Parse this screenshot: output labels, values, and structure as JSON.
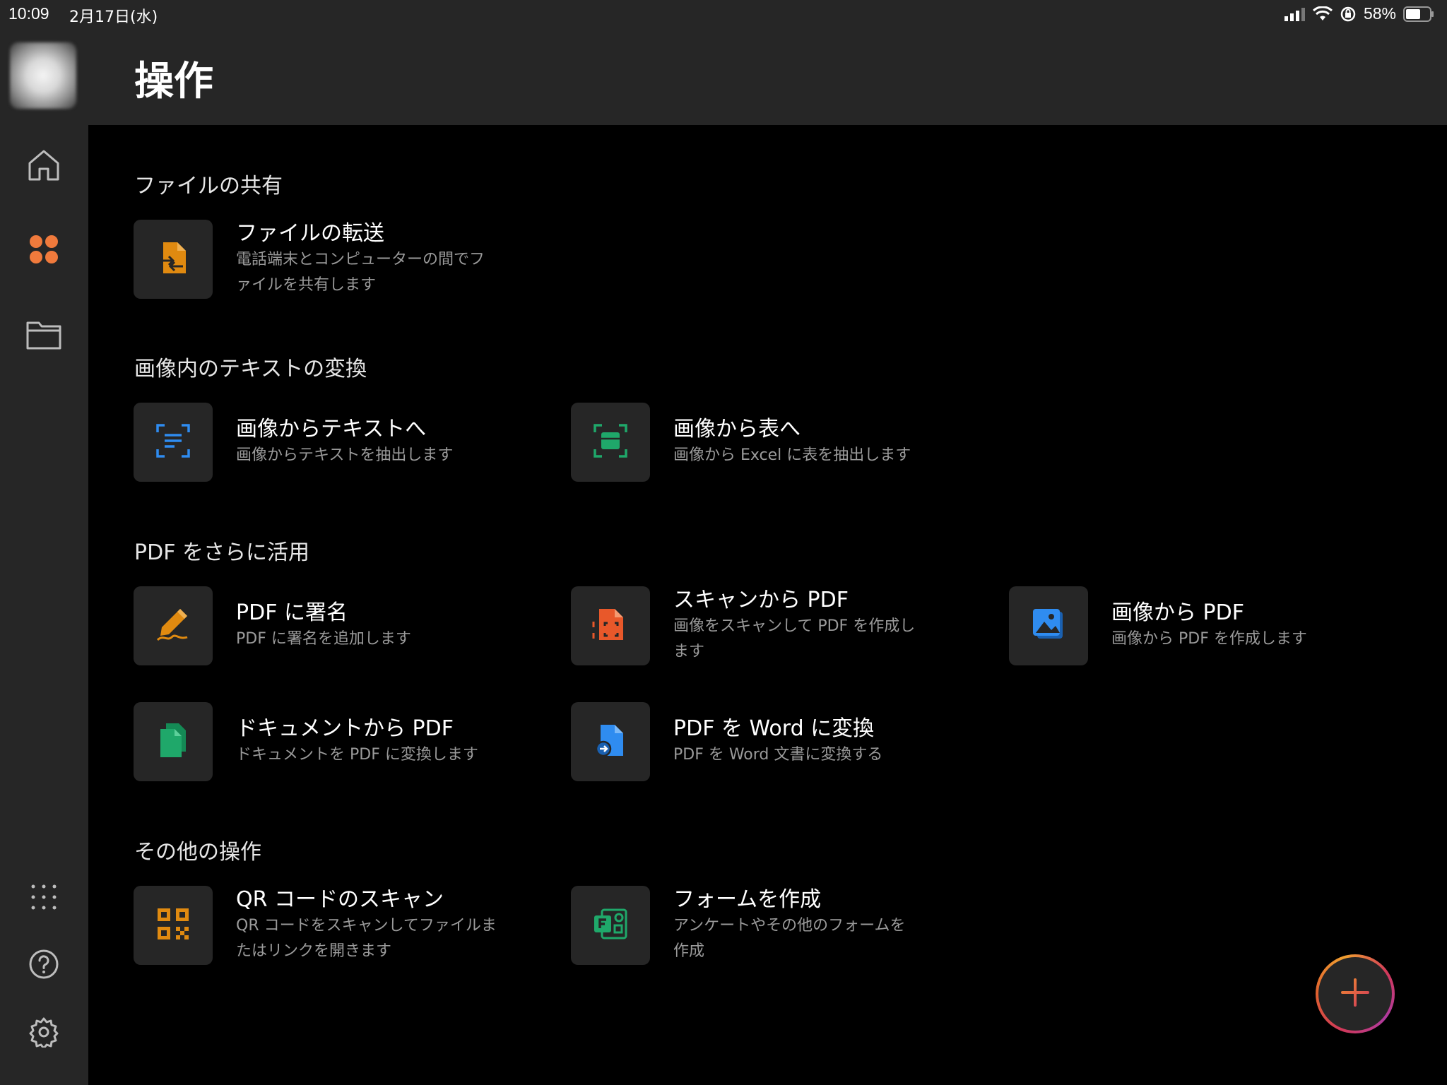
{
  "status_bar": {
    "time": "10:09",
    "date": "2月17日(水)",
    "battery_percent": "58%"
  },
  "header": {
    "title": "操作"
  },
  "sidebar": {
    "items": [
      {
        "name": "home",
        "icon": "home-icon"
      },
      {
        "name": "actions",
        "icon": "grid-icon",
        "active": true
      },
      {
        "name": "files",
        "icon": "folder-icon"
      },
      {
        "name": "more",
        "icon": "dots-grid-icon"
      },
      {
        "name": "help",
        "icon": "help-icon"
      },
      {
        "name": "settings",
        "icon": "gear-icon"
      }
    ]
  },
  "sections": [
    {
      "title": "ファイルの共有",
      "cards": [
        {
          "title": "ファイルの転送",
          "desc1": "電話端末とコンピューターの間でフ",
          "desc2": "ァイルを共有します",
          "icon": "file-transfer-icon",
          "color": "#e08a10"
        }
      ]
    },
    {
      "title": "画像内のテキストの変換",
      "cards": [
        {
          "title": "画像からテキストへ",
          "desc1": "画像からテキストを抽出します",
          "icon": "image-to-text-icon",
          "color": "#2f8cf0"
        },
        {
          "title": "画像から表へ",
          "desc1": "画像から Excel に表を抽出します",
          "icon": "image-to-table-icon",
          "color": "#1fa86a"
        }
      ]
    },
    {
      "title": "PDF をさらに活用",
      "cards": [
        {
          "title": "PDF に署名",
          "desc1": "PDF に署名を追加します",
          "icon": "sign-pen-icon",
          "color": "#e08a10"
        },
        {
          "title": "スキャンから PDF",
          "desc1": "画像をスキャンして PDF を作成し",
          "desc2": "ます",
          "icon": "scan-to-pdf-icon",
          "color": "#e8582a"
        },
        {
          "title": "画像から PDF",
          "desc1": "画像から PDF を作成します",
          "icon": "image-to-pdf-icon",
          "color": "#2f8cf0"
        },
        {
          "title": "ドキュメントから PDF",
          "desc1": "ドキュメントを PDF に変換します",
          "icon": "doc-to-pdf-icon",
          "color": "#1fa86a"
        },
        {
          "title": "PDF を Word に変換",
          "desc1": "PDF を Word 文書に変換する",
          "icon": "pdf-to-word-icon",
          "color": "#2f8cf0"
        }
      ]
    },
    {
      "title": "その他の操作",
      "cards": [
        {
          "title": "QR コードのスキャン",
          "desc1": "QR コードをスキャンしてファイルま",
          "desc2": "たはリンクを開きます",
          "icon": "qr-code-icon",
          "color": "#e08a10"
        },
        {
          "title": "フォームを作成",
          "desc1": "アンケートやその他のフォームを",
          "desc2": "作成",
          "icon": "forms-icon",
          "color": "#1fa86a"
        }
      ]
    }
  ],
  "fab": {
    "icon": "plus-icon"
  }
}
